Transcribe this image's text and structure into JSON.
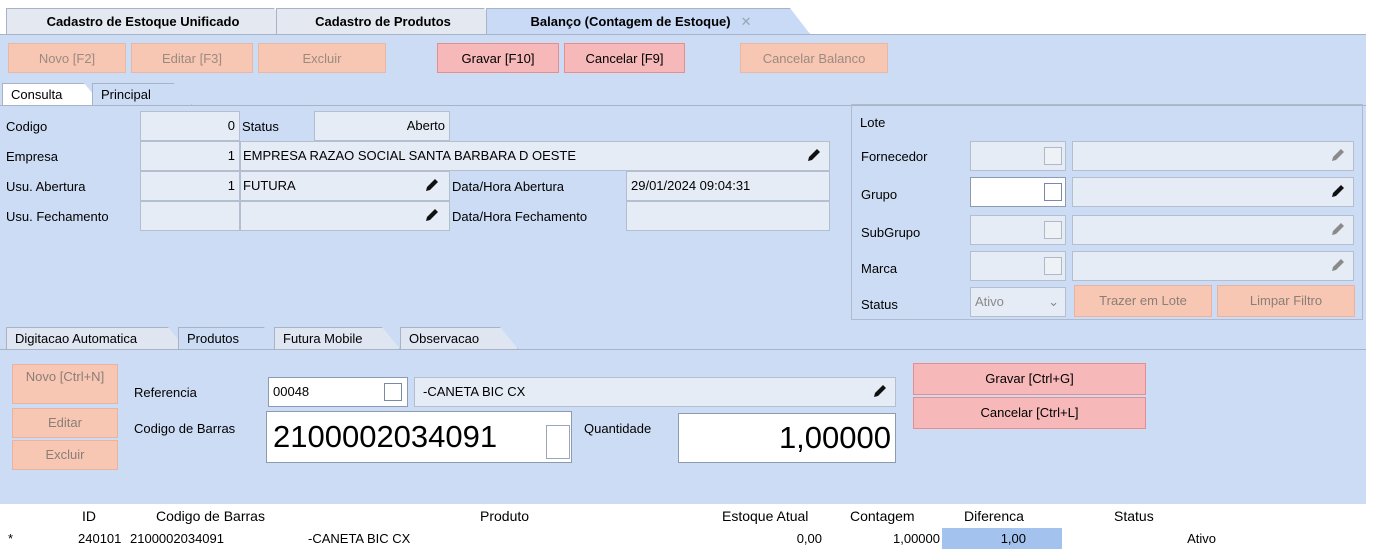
{
  "top_tabs": [
    {
      "label": "Cadastro de Estoque Unificado"
    },
    {
      "label": "Cadastro de Produtos"
    },
    {
      "label": "Balanço (Contagem de Estoque)",
      "close": "✕"
    }
  ],
  "toolbar": {
    "novo": "Novo [F2]",
    "editar": "Editar [F3]",
    "excluir": "Excluir",
    "gravar": "Gravar [F10]",
    "cancelar": "Cancelar [F9]",
    "cancelar_balanco": "Cancelar Balanco"
  },
  "sub_tabs": {
    "consulta": "Consulta",
    "principal": "Principal"
  },
  "form": {
    "codigo_label": "Codigo",
    "codigo_value": "0",
    "status_label": "Status",
    "status_value": "Aberto",
    "empresa_label": "Empresa",
    "empresa_id": "1",
    "empresa_name": "EMPRESA RAZAO SOCIAL  SANTA BARBARA D OESTE",
    "usu_abertura_label": "Usu. Abertura",
    "usu_abertura_id": "1",
    "usu_abertura_name": "FUTURA",
    "dh_abertura_label": "Data/Hora Abertura",
    "dh_abertura_value": "29/01/2024 09:04:31",
    "usu_fechamento_label": "Usu. Fechamento",
    "usu_fechamento_id": "",
    "usu_fechamento_name": "",
    "dh_fechamento_label": "Data/Hora Fechamento",
    "dh_fechamento_value": ""
  },
  "lote": {
    "title": "Lote",
    "fornecedor_label": "Fornecedor",
    "grupo_label": "Grupo",
    "subgrupo_label": "SubGrupo",
    "marca_label": "Marca",
    "status_label": "Status",
    "status_value": "Ativo",
    "trazer_btn": "Trazer em Lote",
    "limpar_btn": "Limpar Filtro"
  },
  "lower_tabs": [
    "Digitacao Automatica",
    "Produtos",
    "Futura Mobile",
    "Observacao"
  ],
  "produtos": {
    "novo_btn": "Novo [Ctrl+N]",
    "editar_btn": "Editar",
    "excluir_btn": "Excluir",
    "referencia_label": "Referencia",
    "referencia_value": "00048",
    "referencia_desc": "-CANETA BIC CX",
    "codbarras_label": "Codigo de Barras",
    "codbarras_value": "2100002034091",
    "quantidade_label": "Quantidade",
    "quantidade_value": "1,00000",
    "gravar_btn": "Gravar    [Ctrl+G]",
    "cancelar_btn": "Cancelar [Ctrl+L]"
  },
  "grid": {
    "headers": [
      "ID",
      "Codigo de Barras",
      "Produto",
      "Estoque Atual",
      "Contagem",
      "Diferenca",
      "Status"
    ],
    "rows": [
      {
        "marker": "*",
        "id": "240101",
        "codbarras": "2100002034091",
        "produto": "-CANETA BIC CX",
        "estoque": "0,00",
        "contagem": "1,00000",
        "diferenca": "1,00",
        "status": "Ativo"
      }
    ]
  },
  "colors": {
    "panel": "#cddcf5",
    "disabled_btn": "#f8c7b4",
    "enabled_btn": "#f6b8b8"
  }
}
